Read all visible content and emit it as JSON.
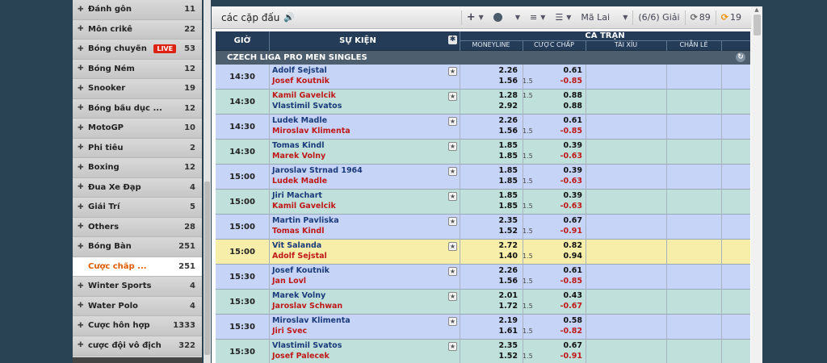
{
  "sidebar": {
    "items": [
      {
        "name": "Đánh gôn",
        "count": "11"
      },
      {
        "name": "Môn crikê",
        "count": "22"
      },
      {
        "name": "Bóng chuyền",
        "count": "53",
        "live": "LIVE"
      },
      {
        "name": "Bóng Ném",
        "count": "12"
      },
      {
        "name": "Snooker",
        "count": "19"
      },
      {
        "name": "Bóng bầu dục ...",
        "count": "12"
      },
      {
        "name": "MotoGP",
        "count": "10"
      },
      {
        "name": "Phi tiêu",
        "count": "2"
      },
      {
        "name": "Boxing",
        "count": "12"
      },
      {
        "name": "Đua Xe Đạp",
        "count": "4"
      },
      {
        "name": "Giải Trí",
        "count": "5"
      },
      {
        "name": "Others",
        "count": "28"
      },
      {
        "name": "Bóng Bàn",
        "count": "251"
      },
      {
        "name": "Cược chấp ...",
        "count": "251",
        "selected": true
      },
      {
        "name": "Winter Sports",
        "count": "4"
      },
      {
        "name": "Water Polo",
        "count": "4"
      },
      {
        "name": "Cược hỗn hợp",
        "count": "1333"
      },
      {
        "name": "cược đội vô địch",
        "count": "322"
      }
    ]
  },
  "toolbar": {
    "title": "các cặp đấu",
    "odds_type": "Mã Lai",
    "league_count": "(6/6) Giải",
    "refresh_count_1": "89",
    "refresh_count_2": "19"
  },
  "table": {
    "col_time": "GIỜ",
    "col_event": "SỰ KIỆN",
    "group_full": "CẢ TRẬN",
    "sub_moneyline": "MONEYLINE",
    "sub_handicap": "CƯỢC CHẤP",
    "sub_overunder": "TÀI XỈU",
    "sub_oddeven": "CHẴN LẺ",
    "league": "CZECH LIGA PRO MEN SINGLES"
  },
  "matches": [
    {
      "time": "14:30",
      "team1": "Adolf Sejstal",
      "team2": "Josef Koutnik",
      "team1_fav": true,
      "ml1": "2.26",
      "ml2": "1.56",
      "hc_line1": "",
      "hc_line2": "1.5",
      "hc1": "0.61",
      "hc2": "-0.85",
      "bg": "blue"
    },
    {
      "time": "14:30",
      "team1": "Kamil Gavelcik",
      "team2": "Vlastimil Svatos",
      "team1_fav": false,
      "ml1": "1.28",
      "ml2": "2.92",
      "hc_line1": "1.5",
      "hc_line2": "",
      "hc1": "0.88",
      "hc2": "0.88",
      "bg": "green"
    },
    {
      "time": "14:30",
      "team1": "Ludek Madle",
      "team2": "Miroslav Klimenta",
      "team1_fav": true,
      "ml1": "2.26",
      "ml2": "1.56",
      "hc_line1": "",
      "hc_line2": "1.5",
      "hc1": "0.61",
      "hc2": "-0.85",
      "bg": "blue"
    },
    {
      "time": "14:30",
      "team1": "Tomas Kindl",
      "team2": "Marek Volny",
      "team1_fav": true,
      "ml1": "1.85",
      "ml2": "1.85",
      "hc_line1": "",
      "hc_line2": "1.5",
      "hc1": "0.39",
      "hc2": "-0.63",
      "bg": "green"
    },
    {
      "time": "15:00",
      "team1": "Jaroslav Strnad 1964",
      "team2": "Ludek Madle",
      "team1_fav": true,
      "ml1": "1.85",
      "ml2": "1.85",
      "hc_line1": "",
      "hc_line2": "1.5",
      "hc1": "0.39",
      "hc2": "-0.63",
      "bg": "blue"
    },
    {
      "time": "15:00",
      "team1": "Jiri Machart",
      "team2": "Kamil Gavelcik",
      "team1_fav": true,
      "ml1": "1.85",
      "ml2": "1.85",
      "hc_line1": "",
      "hc_line2": "1.5",
      "hc1": "0.39",
      "hc2": "-0.63",
      "bg": "green"
    },
    {
      "time": "15:00",
      "team1": "Martin Pavliska",
      "team2": "Tomas Kindl",
      "team1_fav": true,
      "ml1": "2.35",
      "ml2": "1.52",
      "hc_line1": "",
      "hc_line2": "1.5",
      "hc1": "0.67",
      "hc2": "-0.91",
      "bg": "blue"
    },
    {
      "time": "15:00",
      "team1": "Vit Salanda",
      "team2": "Adolf Sejstal",
      "team1_fav": true,
      "ml1": "2.72",
      "ml2": "1.40",
      "hc_line1": "",
      "hc_line2": "1.5",
      "hc1": "0.82",
      "hc2": "0.94",
      "bg": "yellow"
    },
    {
      "time": "15:30",
      "team1": "Josef Koutnik",
      "team2": "Jan Lovl",
      "team1_fav": true,
      "ml1": "2.26",
      "ml2": "1.56",
      "hc_line1": "",
      "hc_line2": "1.5",
      "hc1": "0.61",
      "hc2": "-0.85",
      "bg": "blue"
    },
    {
      "time": "15:30",
      "team1": "Marek Volny",
      "team2": "Jaroslav Schwan",
      "team1_fav": true,
      "ml1": "2.01",
      "ml2": "1.72",
      "hc_line1": "",
      "hc_line2": "1.5",
      "hc1": "0.43",
      "hc2": "-0.67",
      "bg": "green"
    },
    {
      "time": "15:30",
      "team1": "Miroslav Klimenta",
      "team2": "Jiri Svec",
      "team1_fav": true,
      "ml1": "2.19",
      "ml2": "1.61",
      "hc_line1": "",
      "hc_line2": "1.5",
      "hc1": "0.58",
      "hc2": "-0.82",
      "bg": "blue"
    },
    {
      "time": "15:30",
      "team1": "Vlastimil Svatos",
      "team2": "Josef Palecek",
      "team1_fav": true,
      "ml1": "2.35",
      "ml2": "1.52",
      "hc_line1": "",
      "hc_line2": "1.5",
      "hc1": "0.67",
      "hc2": "-0.91",
      "bg": "green"
    }
  ],
  "icons": {
    "speaker": "speaker-icon",
    "add": "plus-icon",
    "clock": "clock-icon",
    "sort": "sort-icon",
    "list": "list-view-icon",
    "refresh": "refresh-icon",
    "star": "star-icon"
  },
  "colors": {
    "header": "#243c57",
    "league_bar": "#4d5e6f",
    "row_blue": "#c6d5f7",
    "row_green": "#bfe0db",
    "row_yellow": "#f7eeaa",
    "fav_team": "#1a3a7a",
    "underdog_team": "#c01818",
    "selected_sport": "#e05a00",
    "live_badge": "#dd2211"
  }
}
